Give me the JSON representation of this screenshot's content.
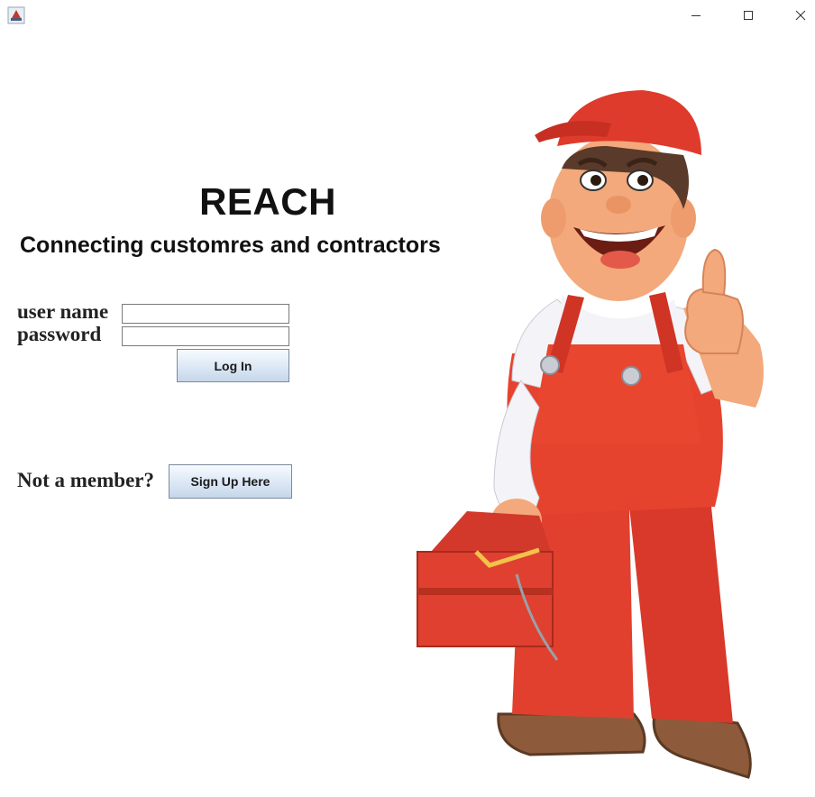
{
  "window": {
    "app_icon": "java-app-icon",
    "controls": [
      "minimize-icon",
      "maximize-icon",
      "close-icon"
    ]
  },
  "brand": {
    "title": "REACH",
    "tagline": "Connecting customres and contractors"
  },
  "login": {
    "username_label": "user name",
    "username_value": "",
    "password_label": "password",
    "password_value": "",
    "login_button": "Log In"
  },
  "signup": {
    "prompt": "Not a member?",
    "button": "Sign Up Here"
  },
  "illustration": {
    "subject": "contractor mascot giving thumbs up holding toolbox",
    "colors": {
      "overalls": "#e4402f",
      "cap": "#dc3a2c",
      "skin": "#f2a87a",
      "shirt": "#f2f2f6",
      "boots": "#8a5a3a"
    }
  }
}
